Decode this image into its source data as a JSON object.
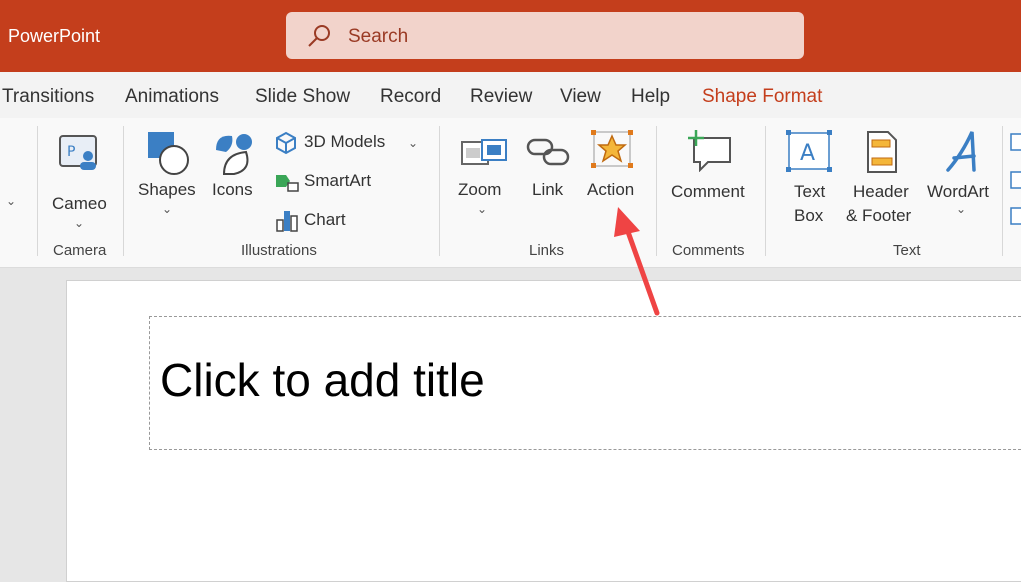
{
  "app": {
    "name": "PowerPoint"
  },
  "search": {
    "placeholder": "Search"
  },
  "tabs": [
    "Transitions",
    "Animations",
    "Slide Show",
    "Record",
    "Review",
    "View",
    "Help",
    "Shape Format"
  ],
  "ribbon": {
    "camera": {
      "button": "Cameo",
      "group": "Camera"
    },
    "illustrations": {
      "shapes": "Shapes",
      "icons": "Icons",
      "models": "3D Models",
      "smartart": "SmartArt",
      "chart": "Chart",
      "group": "Illustrations"
    },
    "links": {
      "zoom": "Zoom",
      "link": "Link",
      "action": "Action",
      "group": "Links"
    },
    "comments": {
      "comment": "Comment",
      "group": "Comments"
    },
    "text": {
      "textbox_1": "Text",
      "textbox_2": "Box",
      "header_1": "Header",
      "header_2": "& Footer",
      "wordart": "WordArt",
      "group": "Text"
    }
  },
  "slide": {
    "title_placeholder": "Click to add title"
  },
  "colors": {
    "accent": "#c43e1c",
    "annotation_arrow": "#ef4444"
  }
}
